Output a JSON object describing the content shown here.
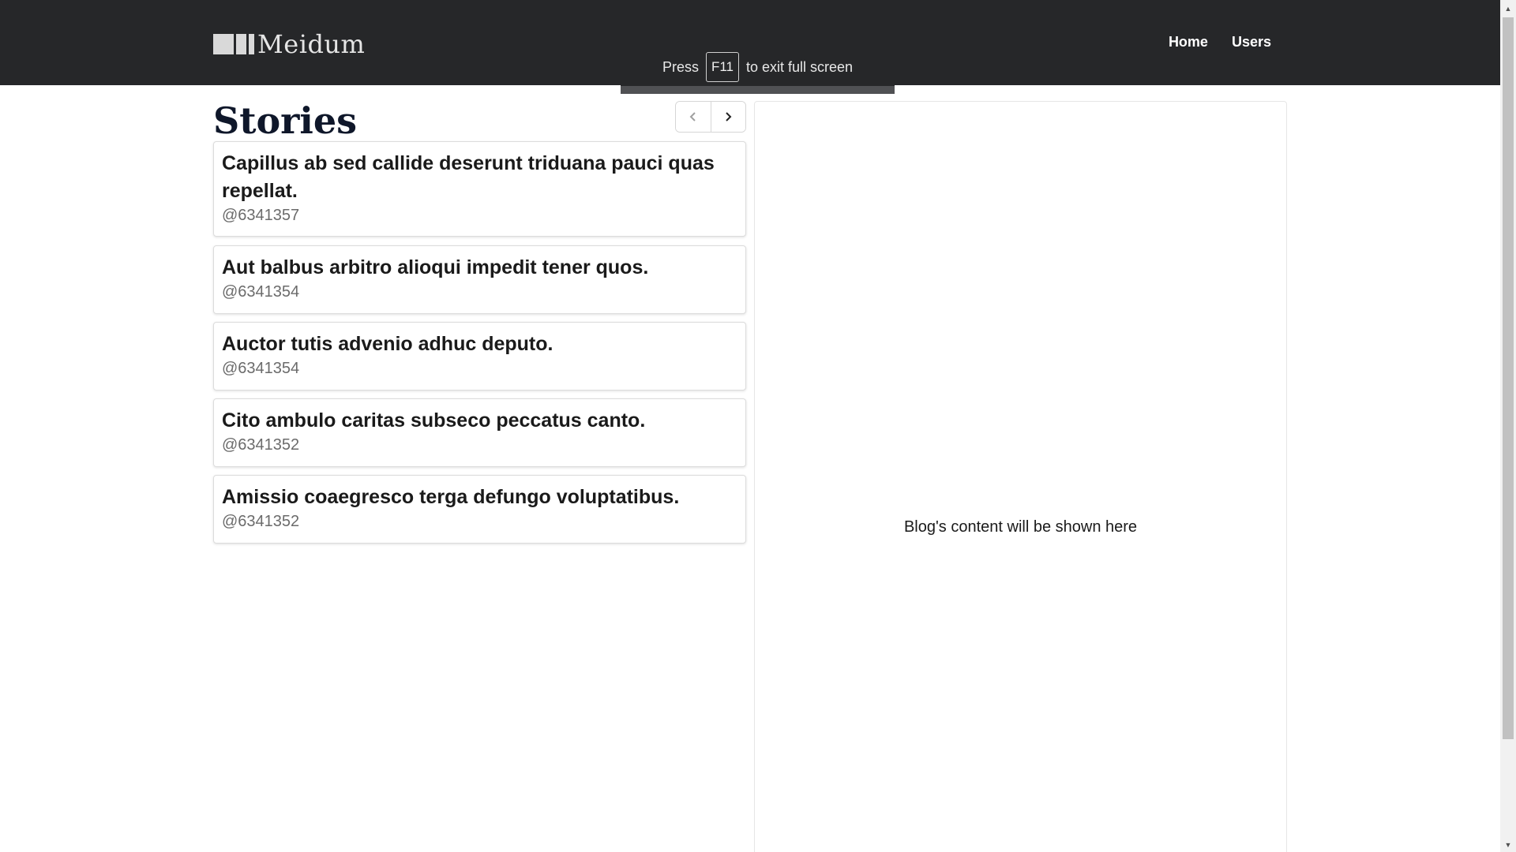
{
  "header": {
    "brand": "Meidum",
    "nav": [
      {
        "label": "Home"
      },
      {
        "label": "Users"
      }
    ]
  },
  "fullscreen_notice": {
    "before": "Press",
    "key": "F11",
    "after": "to exit full screen"
  },
  "stories": {
    "title": "Stories",
    "pager": {
      "prev_icon": "chevron-left-icon",
      "next_icon": "chevron-right-icon"
    },
    "items": [
      {
        "title": "Capillus ab sed callide deserunt triduana pauci quas repellat.",
        "author": "@6341357"
      },
      {
        "title": "Aut balbus arbitro alioqui impedit tener quos.",
        "author": "@6341354"
      },
      {
        "title": "Auctor tutis advenio adhuc deputo.",
        "author": "@6341354"
      },
      {
        "title": "Cito ambulo caritas subseco peccatus canto.",
        "author": "@6341352"
      },
      {
        "title": "Amissio coaegresco terga defungo voluptatibus.",
        "author": "@6341352"
      }
    ]
  },
  "content": {
    "placeholder": "Blog's content will be shown here"
  },
  "colors": {
    "navbar": "#262729",
    "title": "#0f172a",
    "muted": "#6b6b6b"
  }
}
